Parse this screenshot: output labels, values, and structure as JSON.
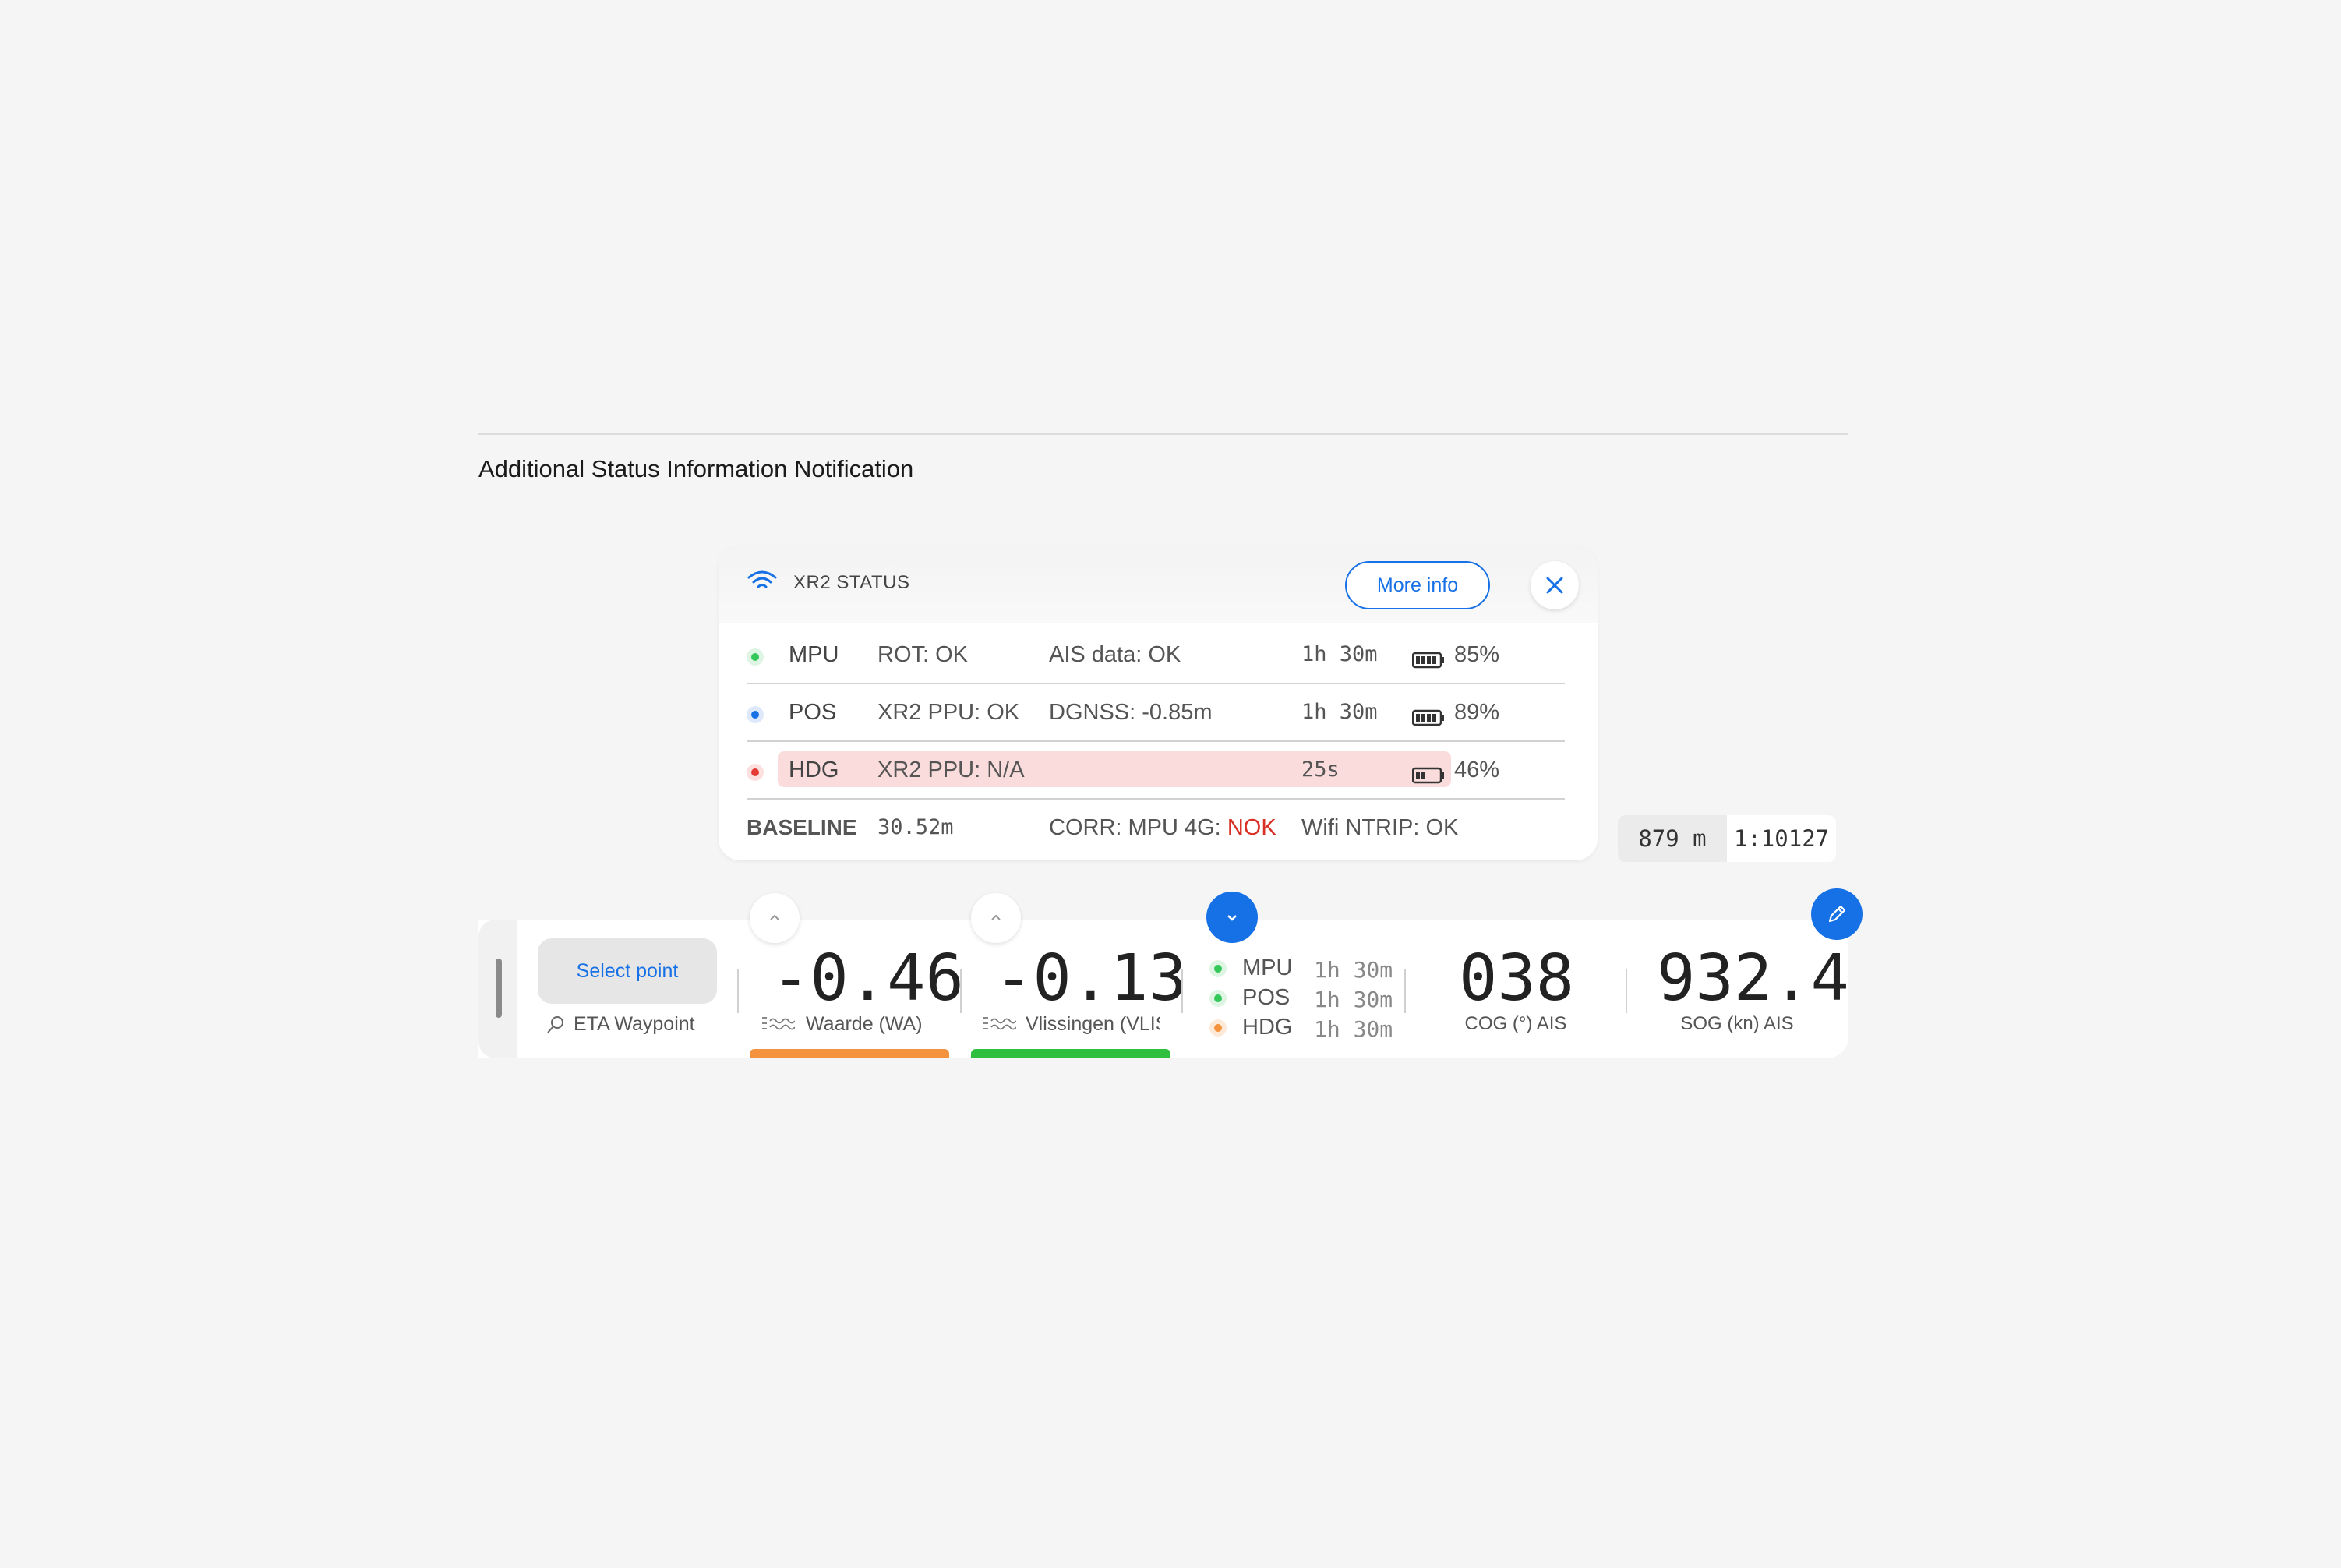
{
  "section_title": "Additional Status Information Notification",
  "status_card": {
    "title": "XR2 STATUS",
    "more_info": "More info",
    "rows": [
      {
        "name": "MPU",
        "c2": "ROT: OK",
        "c3": "AIS data: OK",
        "c4": "1h 30m",
        "battery": "85%",
        "dot_color": "#34c759"
      },
      {
        "name": "POS",
        "c2": "XR2 PPU: OK",
        "c3": "DGNSS: -0.85m",
        "c4": "1h 30m",
        "battery": "89%",
        "dot_color": "#1670e6"
      },
      {
        "name": "HDG",
        "c2": "XR2 PPU: N/A",
        "c3": "",
        "c4": "25s",
        "battery": "46%",
        "dot_color": "#e53935"
      }
    ],
    "baseline": {
      "label": "BASELINE",
      "value": "30.52m",
      "corr": "CORR: MPU 4G:",
      "corr_status": "NOK",
      "wifi": "Wifi NTRIP: OK"
    }
  },
  "scale": {
    "distance": "879 m",
    "ratio": "1:10127"
  },
  "bottom_bar": {
    "select_point": "Select point",
    "eta_label": "ETA Waypoint",
    "tides": [
      {
        "value": "-0.46",
        "label": "Waarde (WA)",
        "bar_color": "#f5923e"
      },
      {
        "value": "-0.13",
        "label": "Vlissingen (VLIS)",
        "bar_color": "#2fbf3f"
      }
    ],
    "mini_status": [
      {
        "name": "MPU",
        "time": "1h 30m",
        "dot_color": "#34c759"
      },
      {
        "name": "POS",
        "time": "1h 30m",
        "dot_color": "#34c759"
      },
      {
        "name": "HDG",
        "time": "1h 30m",
        "dot_color": "#f5923e"
      }
    ],
    "cog": {
      "value": "038",
      "label": "COG (°) AIS"
    },
    "sog": {
      "value": "932.4",
      "label": "SOG (kn) AIS"
    }
  }
}
